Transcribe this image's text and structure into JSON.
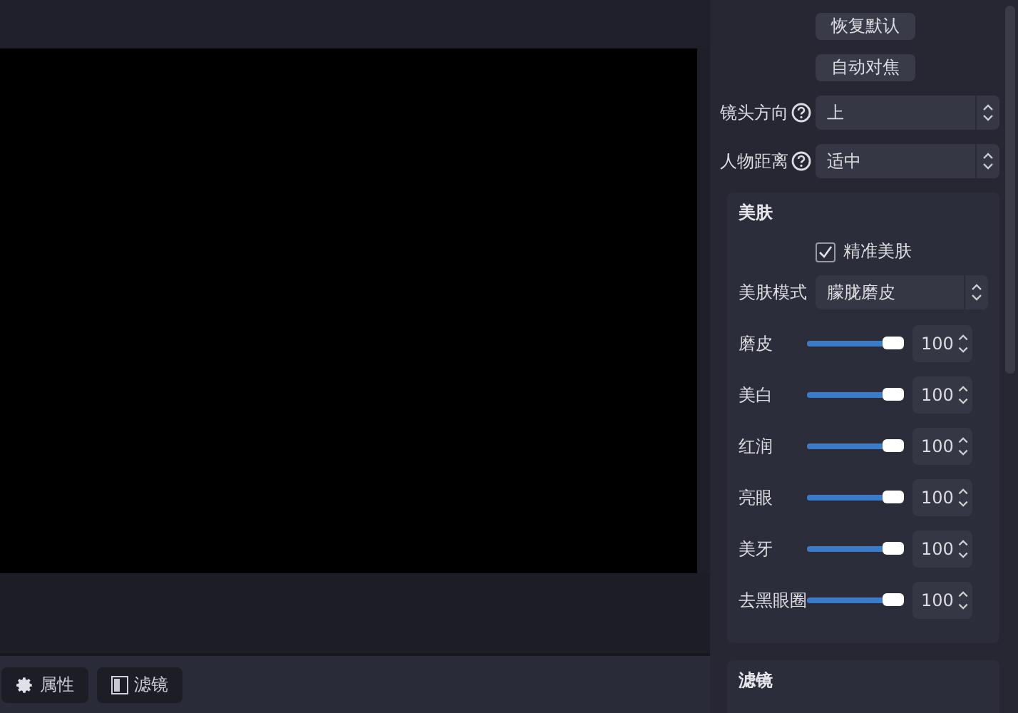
{
  "toolbar": [
    {
      "label": "属性",
      "kind": "gear"
    },
    {
      "label": "滤镜",
      "kind": "filter"
    }
  ],
  "panel": {
    "buttons": [
      "恢复默认",
      "自动对焦"
    ],
    "selects": [
      {
        "label": "镜头方向",
        "value": "上"
      },
      {
        "label": "人物距离",
        "value": "适中"
      }
    ],
    "beauty": {
      "title": "美肤",
      "precise": {
        "label": "精准美肤",
        "checked": true
      },
      "mode": {
        "label": "美肤模式",
        "value": "朦胧磨皮"
      },
      "sliders": [
        {
          "label": "磨皮",
          "level": 1,
          "value": "100"
        },
        {
          "label": "美白",
          "level": 1,
          "value": "100"
        },
        {
          "label": "红润",
          "level": 1,
          "value": "100"
        },
        {
          "label": "亮眼",
          "level": 1,
          "value": "100"
        },
        {
          "label": "美牙",
          "level": 1,
          "value": "100"
        },
        {
          "label": "去黑眼圈",
          "level": 1,
          "value": "100"
        }
      ]
    },
    "filter_section": {
      "title": "滤镜"
    }
  }
}
